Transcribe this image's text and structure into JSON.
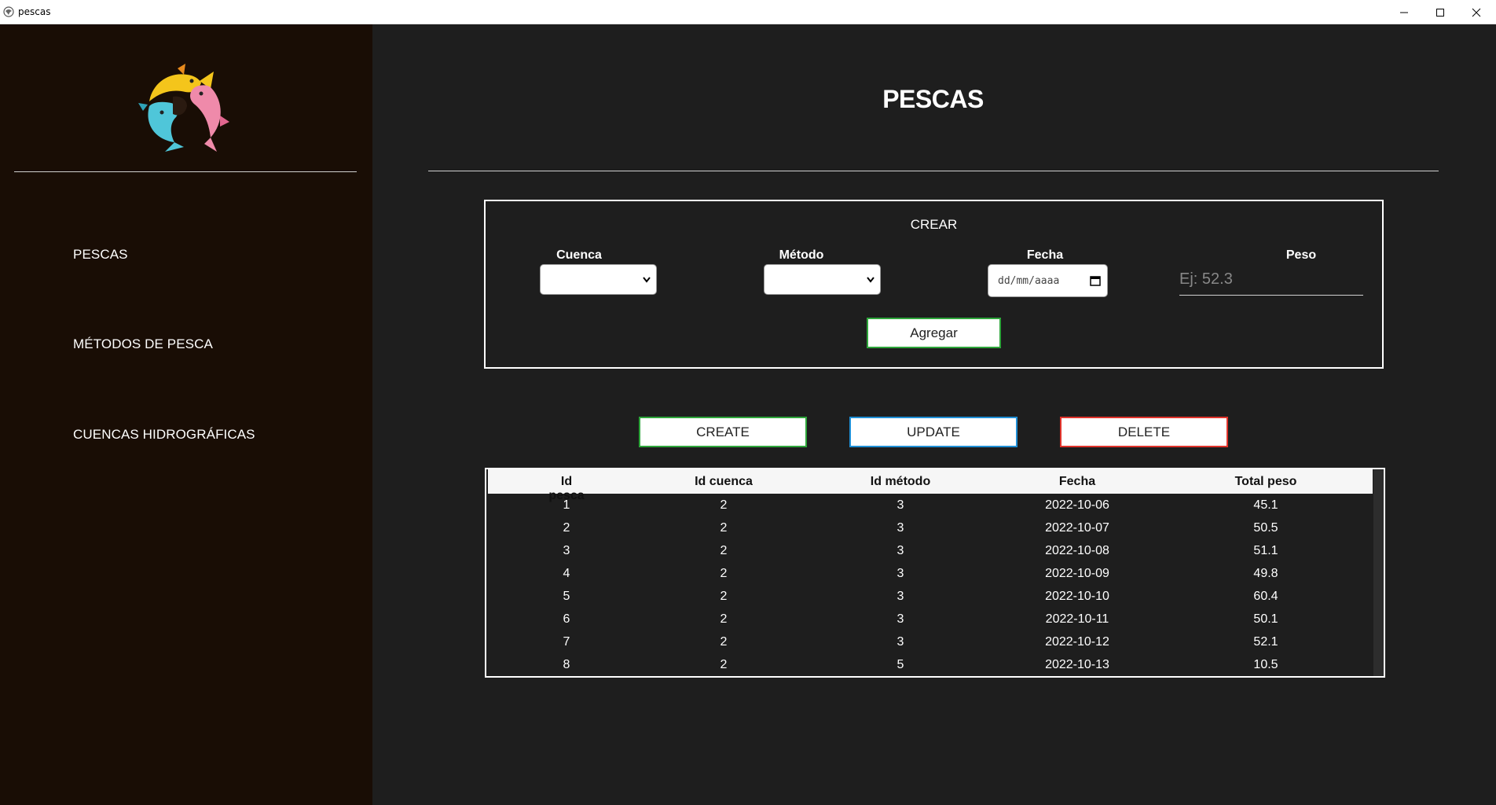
{
  "window": {
    "title": "pescas"
  },
  "sidebar": {
    "items": [
      {
        "label": "PESCAS"
      },
      {
        "label": "MÉTODOS DE PESCA"
      },
      {
        "label": "CUENCAS HIDROGRÁFICAS"
      }
    ]
  },
  "main": {
    "title": "PESCAS",
    "crear": {
      "title": "CREAR",
      "cuenca_label": "Cuenca",
      "metodo_label": "Método",
      "fecha_label": "Fecha",
      "fecha_placeholder": "dd/mm/aaaa",
      "peso_label": "Peso",
      "peso_placeholder": "Ej: 52.3",
      "submit_label": "Agregar"
    },
    "actions": {
      "create": "CREATE",
      "update": "UPDATE",
      "delete": "DELETE"
    },
    "table": {
      "headers": [
        "Id pesca",
        "Id cuenca",
        "Id método",
        "Fecha",
        "Total peso"
      ],
      "rows": [
        [
          "1",
          "2",
          "3",
          "2022-10-06",
          "45.1"
        ],
        [
          "2",
          "2",
          "3",
          "2022-10-07",
          "50.5"
        ],
        [
          "3",
          "2",
          "3",
          "2022-10-08",
          "51.1"
        ],
        [
          "4",
          "2",
          "3",
          "2022-10-09",
          "49.8"
        ],
        [
          "5",
          "2",
          "3",
          "2022-10-10",
          "60.4"
        ],
        [
          "6",
          "2",
          "3",
          "2022-10-11",
          "50.1"
        ],
        [
          "7",
          "2",
          "3",
          "2022-10-12",
          "52.1"
        ],
        [
          "8",
          "2",
          "5",
          "2022-10-13",
          "10.5"
        ]
      ]
    }
  },
  "colors": {
    "sidebar_bg": "#190d05",
    "main_bg": "#1e1e1e",
    "create_green": "#2ea63b",
    "update_blue": "#1f8fd6",
    "delete_red": "#e0332b"
  }
}
